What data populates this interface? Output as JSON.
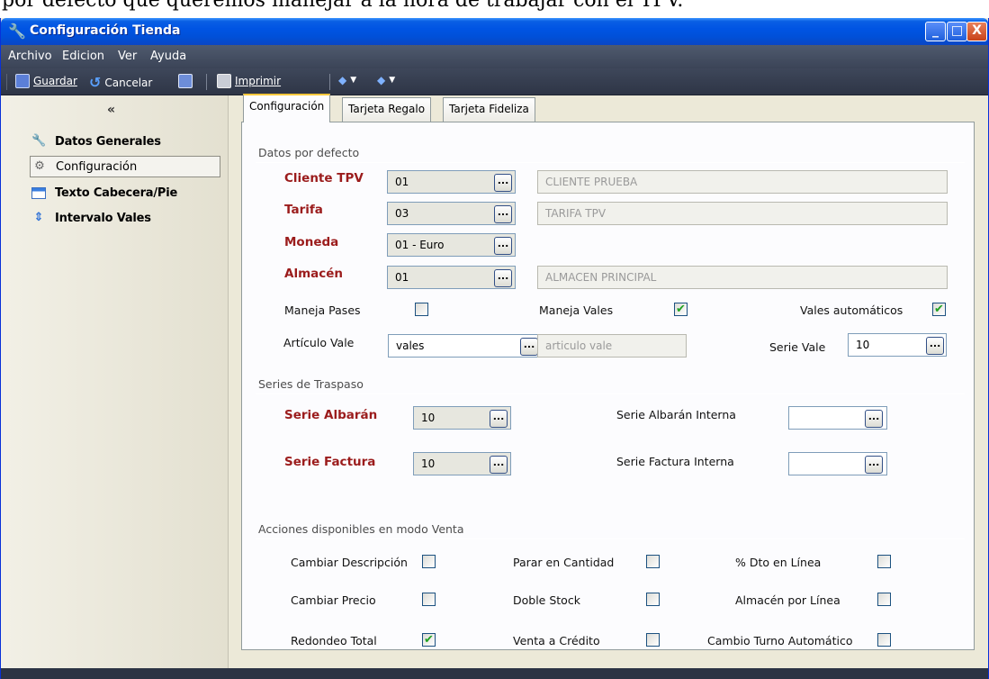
{
  "caption": "por defecto que queremos manejar a la hora de trabajar con el TPV.",
  "window": {
    "title": "Configuración Tienda",
    "buttons": {
      "minimize": "_",
      "maximize": "□",
      "close": "X"
    }
  },
  "menu": [
    {
      "label": "Archivo"
    },
    {
      "label": "Edicion"
    },
    {
      "label": "Ver"
    },
    {
      "label": "Ayuda"
    }
  ],
  "toolbar": {
    "save": "Guardar",
    "cancel": "Cancelar",
    "print": "Imprimir"
  },
  "sidebar": {
    "collapse": "«",
    "items": [
      {
        "label": "Datos Generales",
        "icon": "wrench-icon"
      },
      {
        "label": "Configuración",
        "icon": "gear-icon"
      },
      {
        "label": "Texto Cabecera/Pie",
        "icon": "window-icon"
      },
      {
        "label": "Intervalo Vales",
        "icon": "updown-arrows-icon"
      }
    ]
  },
  "tabs": [
    "Configuración",
    "Tarjeta Regalo",
    "Tarjeta Fideliza"
  ],
  "defaults": {
    "title": "Datos por defecto",
    "cliente": {
      "label": "Cliente TPV",
      "code": "01",
      "desc": "CLIENTE PRUEBA"
    },
    "tarifa": {
      "label": "Tarifa",
      "code": "03",
      "desc": "TARIFA TPV"
    },
    "moneda": {
      "label": "Moneda",
      "code": "01 - Euro"
    },
    "almacen": {
      "label": "Almacén",
      "code": "01",
      "desc": "ALMACEN PRINCIPAL"
    },
    "maneja_pases": {
      "label": "Maneja Pases",
      "checked": false
    },
    "maneja_vales": {
      "label": "Maneja Vales",
      "checked": true
    },
    "vales_auto": {
      "label": "Vales automáticos",
      "checked": true
    },
    "articulo_vale": {
      "label": "Artículo Vale",
      "code": "vales",
      "desc": "articulo vale"
    },
    "serie_vale": {
      "label": "Serie Vale",
      "value": "10"
    }
  },
  "traspaso": {
    "title": "Series de Traspaso",
    "serie_albaran": {
      "label": "Serie Albarán",
      "value": "10"
    },
    "serie_factura": {
      "label": "Serie Factura",
      "value": "10"
    },
    "serie_albaran_interna": {
      "label": "Serie Albarán Interna",
      "value": ""
    },
    "serie_factura_interna": {
      "label": "Serie Factura Interna",
      "value": ""
    }
  },
  "acciones": {
    "title": "Acciones disponibles en modo Venta",
    "items": [
      {
        "label": "Cambiar Descripción",
        "checked": false
      },
      {
        "label": "Parar en Cantidad",
        "checked": false
      },
      {
        "label": "% Dto en Línea",
        "checked": false
      },
      {
        "label": "Cambiar Precio",
        "checked": false
      },
      {
        "label": "Doble Stock",
        "checked": false
      },
      {
        "label": "Almacén por Línea",
        "checked": false
      },
      {
        "label": "Redondeo Total",
        "checked": true
      },
      {
        "label": "Venta a Crédito",
        "checked": false
      },
      {
        "label": "Cambio Turno Automático",
        "checked": false
      }
    ]
  },
  "lookup_glyph": "...",
  "check_glyph": "✔"
}
